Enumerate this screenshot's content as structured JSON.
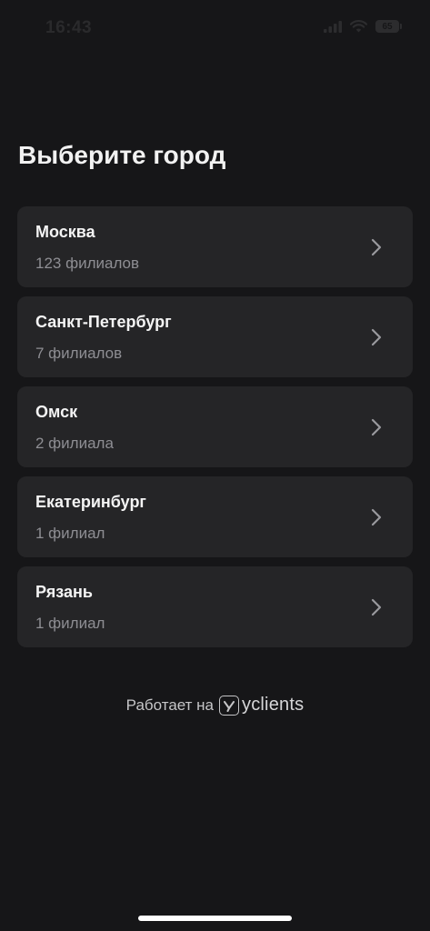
{
  "status_bar": {
    "time": "16:43",
    "battery": "65"
  },
  "header": {
    "title": "Выберите город"
  },
  "cities": [
    {
      "name": "Москва",
      "count": "123 филиалов"
    },
    {
      "name": "Санкт-Петербург",
      "count": "7 филиалов"
    },
    {
      "name": "Омск",
      "count": "2 филиала"
    },
    {
      "name": "Екатеринбург",
      "count": "1 филиал"
    },
    {
      "name": "Рязань",
      "count": "1 филиал"
    }
  ],
  "footer": {
    "powered_by": "Работает на",
    "brand": "yclients"
  },
  "colors": {
    "background": "#161618",
    "card": "#252527",
    "secondary_text": "#8e8e93"
  }
}
